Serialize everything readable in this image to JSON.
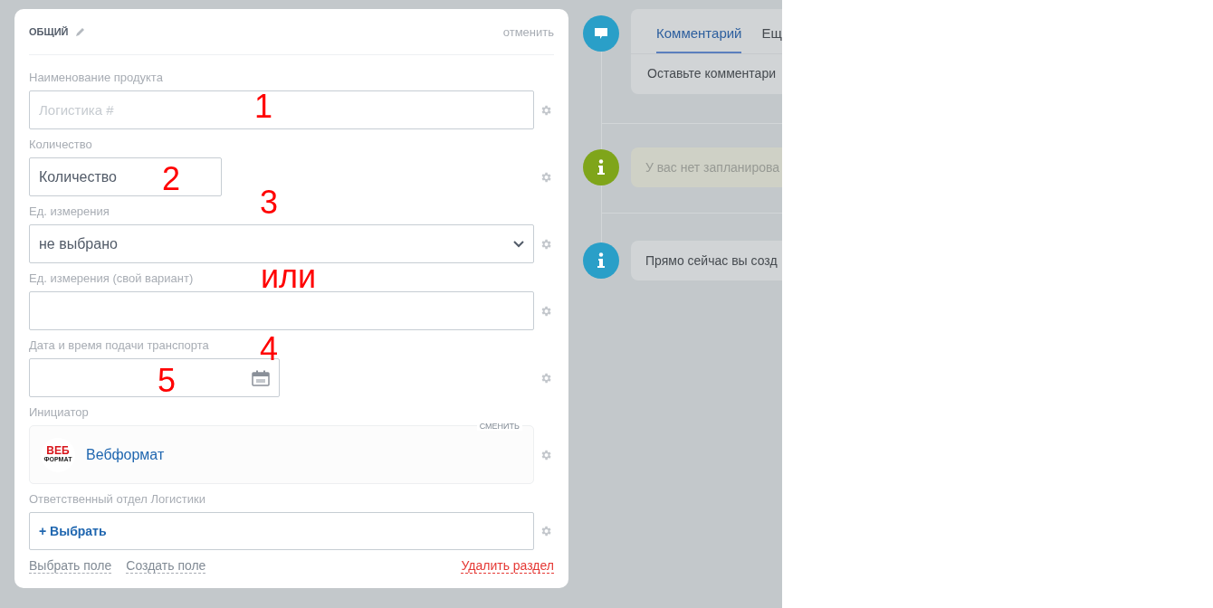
{
  "section": {
    "title": "ОБЩИЙ",
    "cancel": "отменить"
  },
  "fields": [
    {
      "kind": "text",
      "label": "Наименование продукта",
      "placeholder": "Логистика #"
    },
    {
      "kind": "text",
      "label": "Количество",
      "value": "Количество"
    },
    {
      "kind": "select",
      "label": "Ед. измерения",
      "value": "не выбрано"
    },
    {
      "kind": "text",
      "label": "Ед. измерения (свой вариант)"
    },
    {
      "kind": "date",
      "label": "Дата и время подачи транспорта"
    },
    {
      "kind": "entity",
      "label": "Инициатор",
      "change": "СМЕНИТЬ",
      "logo_top": "ВЕБ",
      "logo_bottom": "ФОРМАТ",
      "name": "Вебформат"
    },
    {
      "kind": "add",
      "label": "Ответственный отдел Логистики",
      "button": "+ Выбрать"
    }
  ],
  "footer": {
    "links": [
      "Выбрать поле",
      "Создать поле"
    ],
    "delete": "Удалить раздел"
  },
  "annotations": [
    "1",
    "2",
    "3",
    "или",
    "4",
    "5"
  ],
  "timeline": [
    {
      "kind": "comment",
      "color": "#2a9fc8",
      "tabs": [
        {
          "label": "Комментарий",
          "selected": true
        },
        {
          "label": "Ещ",
          "selected": false
        }
      ],
      "text": "Оставьте комментари"
    },
    {
      "kind": "notice",
      "color": "#7fa51a",
      "text": "У вас нет запланирова"
    },
    {
      "kind": "info",
      "color": "#2a9fc8",
      "text": "Прямо сейчас вы созд"
    }
  ]
}
